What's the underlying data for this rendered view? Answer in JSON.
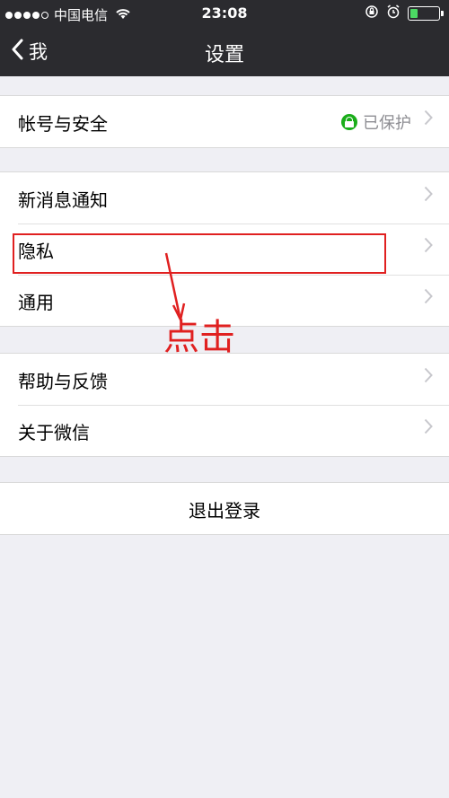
{
  "status_bar": {
    "carrier": "中国电信",
    "time": "23:08",
    "battery_level": 0.25
  },
  "nav": {
    "back_label": "我",
    "title": "设置"
  },
  "groups": [
    {
      "items": [
        {
          "label": "帐号与安全",
          "value": "已保护"
        }
      ]
    },
    {
      "items": [
        {
          "label": "新消息通知"
        },
        {
          "label": "隐私"
        },
        {
          "label": "通用"
        }
      ]
    },
    {
      "items": [
        {
          "label": "帮助与反馈"
        },
        {
          "label": "关于微信"
        }
      ]
    }
  ],
  "logout": {
    "label": "退出登录"
  },
  "annotation": {
    "text": "点击",
    "color": "#e02020"
  },
  "colors": {
    "nav_bg": "#2b2b2f",
    "page_bg": "#efeff4",
    "lock_green": "#1aad19",
    "chevron": "#c7c7cc"
  }
}
